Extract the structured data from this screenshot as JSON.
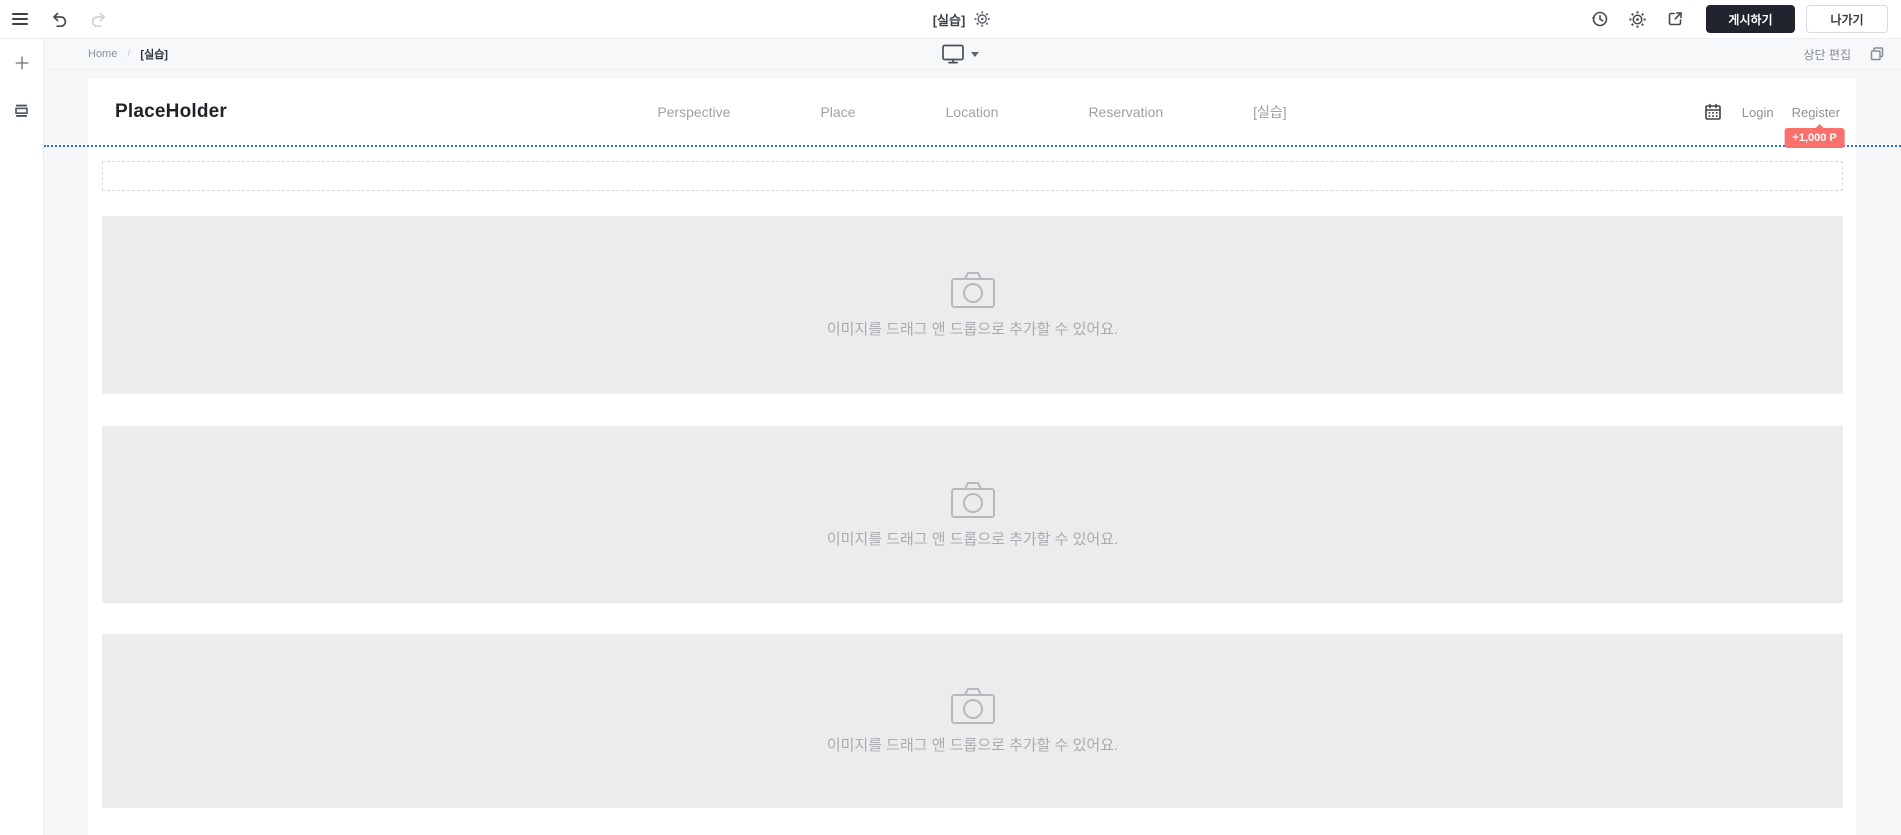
{
  "colors": {
    "accent_blue": "#2e6ee0",
    "badge_red": "#f8716d",
    "publish_button_bg": "#20242e",
    "section_bg": "#ececec",
    "canvas_bg": "#f6f7f9"
  },
  "topbar": {
    "title": "[실습]",
    "publish_label": "게시하기",
    "exit_label": "나가기"
  },
  "subbar": {
    "breadcrumb_home": "Home",
    "breadcrumb_separator": "/",
    "breadcrumb_current": "[실습]",
    "edit_top_label": "상단 편집"
  },
  "site": {
    "logo": "PlaceHolder",
    "nav": [
      "Perspective",
      "Place",
      "Location",
      "Reservation",
      "[실습]"
    ],
    "login_label": "Login",
    "register_label": "Register",
    "point_badge": "+1,000 P",
    "image_dropzone_hint": "이미지를 드래그 앤 드롭으로 추가할 수 있어요."
  }
}
